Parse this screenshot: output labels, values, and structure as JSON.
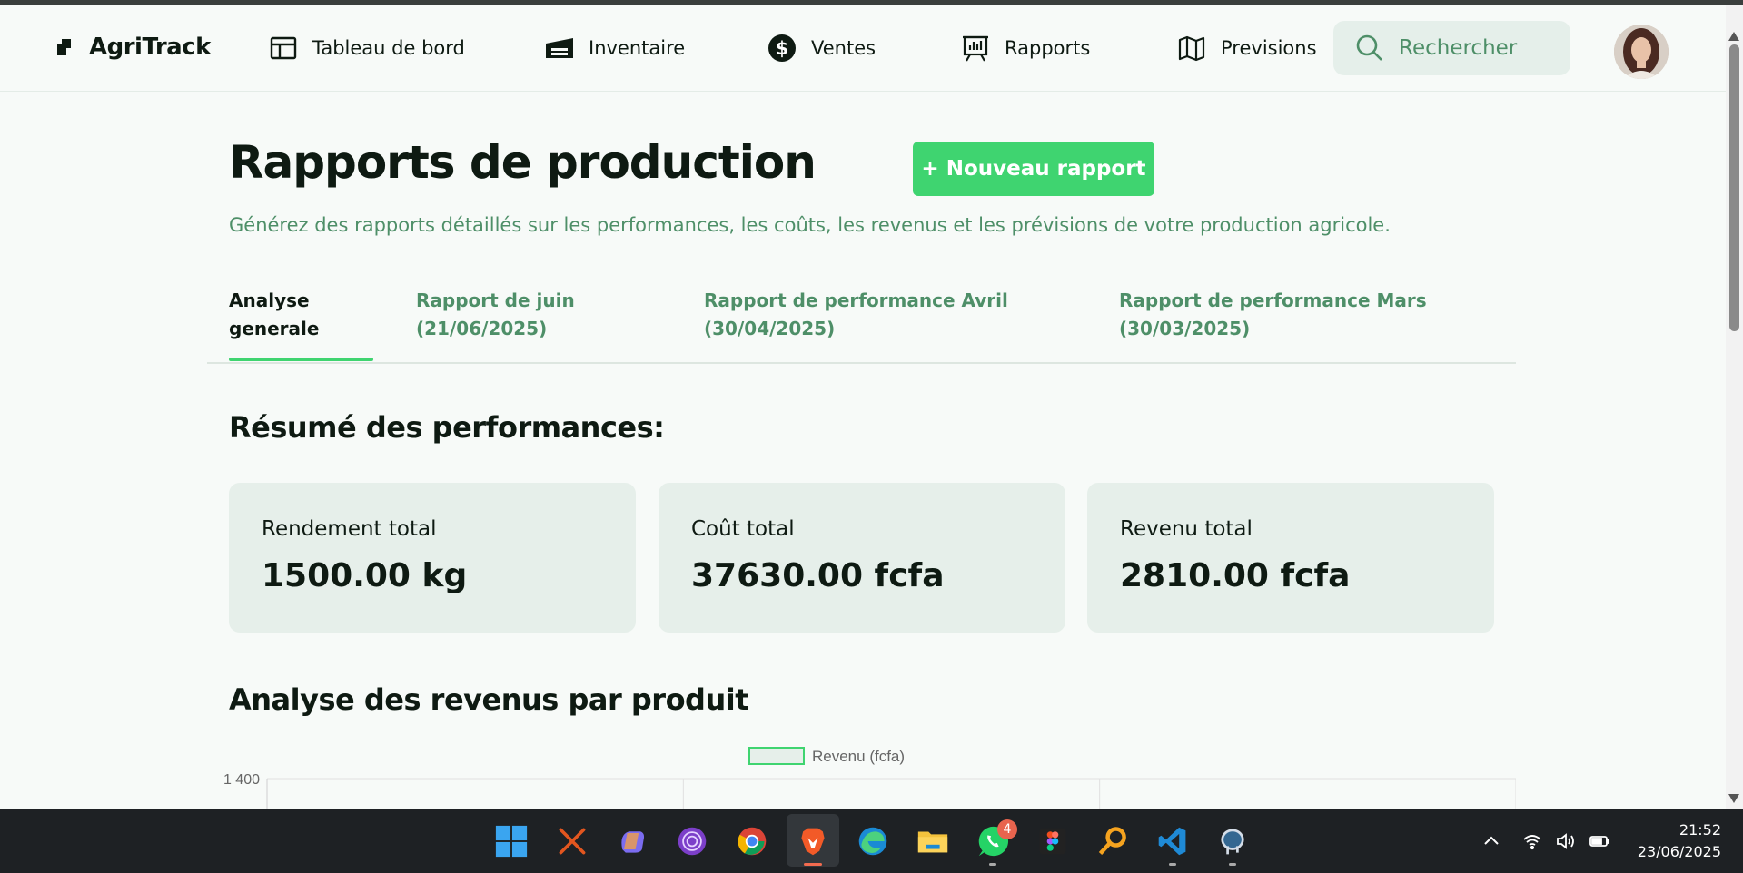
{
  "app": {
    "name": "AgriTrack"
  },
  "nav": {
    "items": [
      {
        "label": "Tableau de bord",
        "icon": "dashboard-icon"
      },
      {
        "label": "Inventaire",
        "icon": "warehouse-icon"
      },
      {
        "label": "Ventes",
        "icon": "dollar-icon"
      },
      {
        "label": "Rapports",
        "icon": "presentation-chart-icon"
      },
      {
        "label": "Previsions",
        "icon": "map-icon"
      }
    ]
  },
  "search": {
    "placeholder": "Rechercher"
  },
  "page": {
    "title": "Rapports de production",
    "new_button_label": "+ Nouveau rapport",
    "subtitle": "Générez des rapports détaillés sur les performances, les coûts, les revenus et les prévisions de votre production agricole."
  },
  "tabs": [
    {
      "line1": "Analyse",
      "line2": "generale",
      "active": true
    },
    {
      "line1": "Rapport de juin",
      "line2": "(21/06/2025)",
      "active": false
    },
    {
      "line1": "Rapport de performance Avril",
      "line2": "(30/04/2025)",
      "active": false
    },
    {
      "line1": "Rapport de performance Mars",
      "line2": "(30/03/2025)",
      "active": false
    }
  ],
  "summary": {
    "title": "Résumé des performances:",
    "cards": [
      {
        "label": "Rendement total",
        "value": "1500.00 kg"
      },
      {
        "label": "Coût total",
        "value": "37630.00 fcfa"
      },
      {
        "label": "Revenu total",
        "value": "2810.00 fcfa"
      }
    ]
  },
  "revenue_analysis": {
    "title": "Analyse des revenus par produit"
  },
  "chart_data": {
    "type": "bar",
    "categories": [],
    "series": [
      {
        "name": "Revenu (fcfa)",
        "values": []
      }
    ],
    "y_tick_labels": [
      "1 400"
    ],
    "legend_position": "top-center",
    "grid": true,
    "colors": {
      "legend_fill": "#e6efea",
      "legend_border": "#3fd470"
    }
  },
  "taskbar": {
    "apps": [
      "windows-start-icon",
      "x-app-icon",
      "copilot-icon",
      "tor-browser-icon",
      "chrome-icon",
      "brave-icon",
      "edge-icon",
      "file-explorer-icon",
      "whatsapp-icon",
      "figma-icon",
      "search-tool-icon",
      "vscode-icon",
      "postgresql-icon"
    ],
    "whatsapp_badge": "4",
    "time": "21:52",
    "date": "23/06/2025"
  },
  "colors": {
    "accent": "#3fd470",
    "muted_green": "#4e8f68",
    "card_bg": "#e6efea",
    "page_bg": "#f7faf8"
  }
}
